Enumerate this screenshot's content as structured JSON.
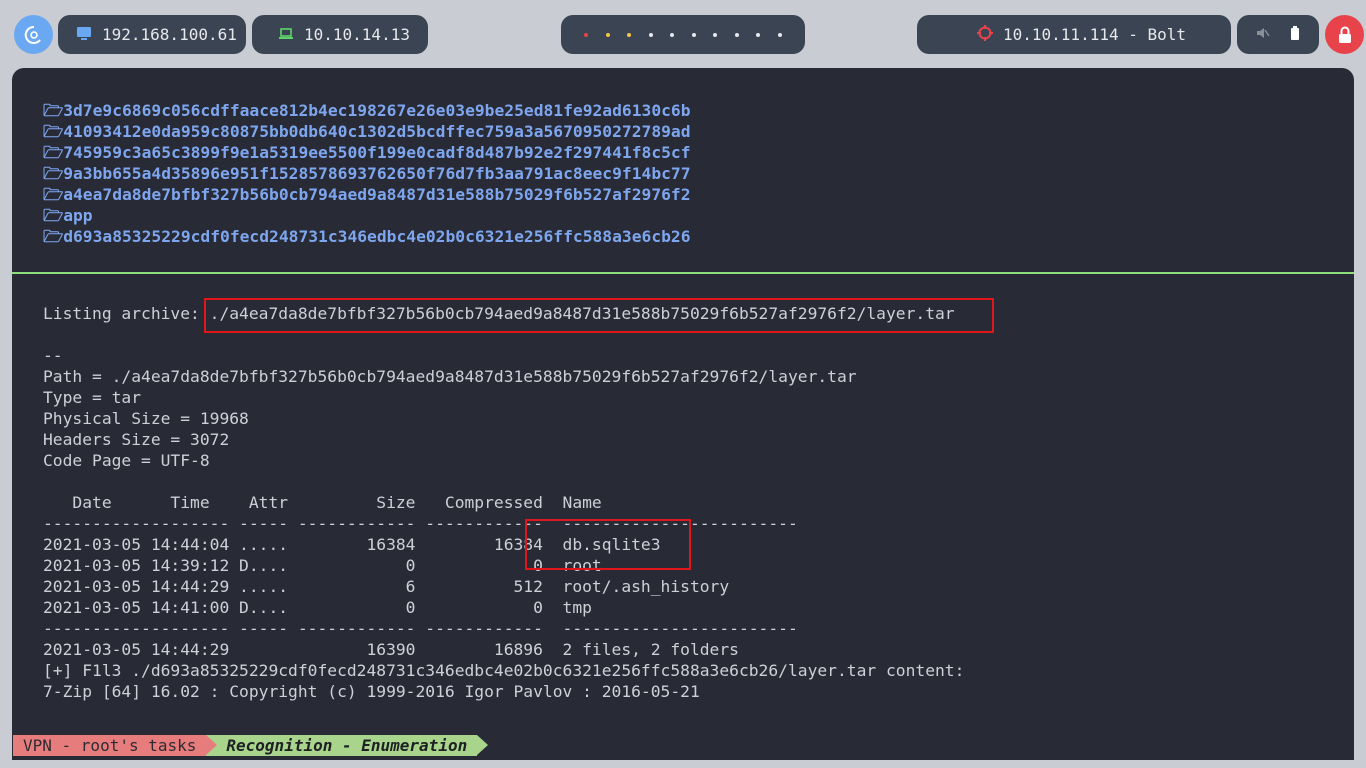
{
  "topbar": {
    "ip_local": "192.168.100.61",
    "ip_vpn": "10.10.14.13",
    "target": "10.10.11.114 - Bolt",
    "colors": {
      "pill_bg": "#3b4452",
      "dot_red": "#e8424a",
      "dot_yellow": "#f2c744",
      "power_bg": "#e8424a"
    },
    "icons": [
      "debian-logo-icon",
      "monitor-icon",
      "laptop-icon",
      "target-icon",
      "mute-icon",
      "battery-icon",
      "power-icon"
    ]
  },
  "terminal": {
    "dirs": [
      "🗁3d7e9c6869c056cdffaace812b4ec198267e26e03e9be25ed81fe92ad6130c6b",
      "🗁41093412e0da959c80875bb0db640c1302d5bcdffec759a3a5670950272789ad",
      "🗁745959c3a65c3899f9e1a5319ee5500f199e0cadf8d487b92e2f297441f8c5cf",
      "🗁9a3bb655a4d35896e951f1528578693762650f76d7fb3aa791ac8eec9f14bc77",
      "🗁a4ea7da8de7bfbf327b56b0cb794aed9a8487d31e588b75029f6b527af2976f2",
      "🗁app",
      "🗁d693a85325229cdf0fecd248731c346edbc4e02b0c6321e256ffc588a3e6cb26"
    ],
    "listing_label": "Listing archive: ",
    "listing_path": "./a4ea7da8de7bfbf327b56b0cb794aed9a8487d31e588b75029f6b527af2976f2/layer.tar",
    "info_lines": [
      "--",
      "Path = ./a4ea7da8de7bfbf327b56b0cb794aed9a8487d31e588b75029f6b527af2976f2/layer.tar",
      "Type = tar",
      "Physical Size = 19968",
      "Headers Size = 3072",
      "Code Page = UTF-8"
    ],
    "table_header": "   Date      Time    Attr         Size   Compressed  Name",
    "sep": "------------------- ----- ------------ ------------  ------------------------",
    "rows": [
      "2021-03-05 14:44:04 .....        16384        16384  db.sqlite3",
      "2021-03-05 14:39:12 D....            0            0  root",
      "2021-03-05 14:44:29 .....            6          512  root/.ash_history",
      "2021-03-05 14:41:00 D....            0            0  tmp"
    ],
    "summary": "2021-03-05 14:44:29              16390        16896  2 files, 2 folders",
    "f1l3": "[+] F1l3 ./d693a85325229cdf0fecd248731c346edbc4e02b0c6321e256ffc588a3e6cb26/layer.tar content:",
    "sevenzip": "7-Zip [64] 16.02 : Copyright (c) 1999-2016 Igor Pavlov : 2016-05-21"
  },
  "statusbar": {
    "left": "VPN - root's tasks",
    "right": "Recognition - Enumeration"
  }
}
